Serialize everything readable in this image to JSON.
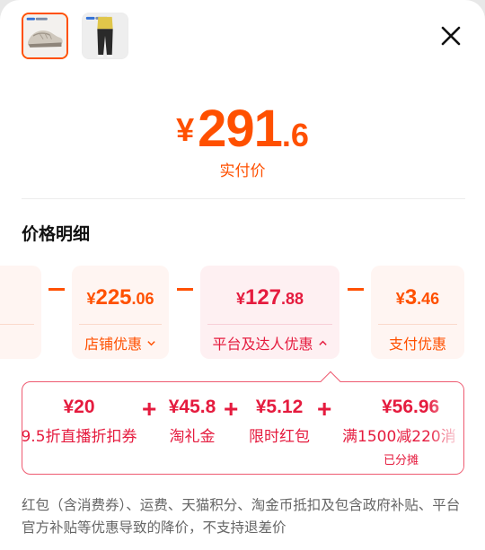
{
  "thumbnails": [
    {
      "name": "shoe-thumbnail",
      "selected": true
    },
    {
      "name": "pants-thumbnail",
      "selected": false
    }
  ],
  "close_icon": "close-icon",
  "price": {
    "currency": "¥",
    "integer": "291",
    "decimal": ".6",
    "label": "实付价"
  },
  "section_title": "价格明细",
  "discount_cards": [
    {
      "currency": "¥",
      "integer": "225",
      "decimal": ".06",
      "label": "店铺优惠",
      "chevron": "chevron-down-icon",
      "chevron_glyph": "⌄",
      "active": false
    },
    {
      "currency": "¥",
      "integer": "127",
      "decimal": ".88",
      "label": "平台及达人优惠",
      "chevron": "chevron-up-icon",
      "chevron_glyph": "⌃",
      "active": true
    },
    {
      "currency": "¥",
      "integer": "3",
      "decimal": ".46",
      "label": "支付优惠",
      "active": false
    }
  ],
  "breakdown": {
    "items": [
      {
        "value": "¥20",
        "label": "9.5折直播折扣券"
      },
      {
        "value": "¥45.8",
        "label": "淘礼金"
      },
      {
        "value": "¥5.12",
        "label": "限时红包"
      },
      {
        "value": "¥56.96",
        "label": "满1500减220消"
      }
    ],
    "plus": "+",
    "note": "已分摊"
  },
  "footnote": "红包（含消费券）、运费、天猫积分、淘金币抵扣及包含政府补贴、平台官方补贴等优惠导致的降价，不支持退差价",
  "colors": {
    "accent": "#ff5000",
    "platform_red": "#e51b3e",
    "border_red": "#ee5a70"
  }
}
